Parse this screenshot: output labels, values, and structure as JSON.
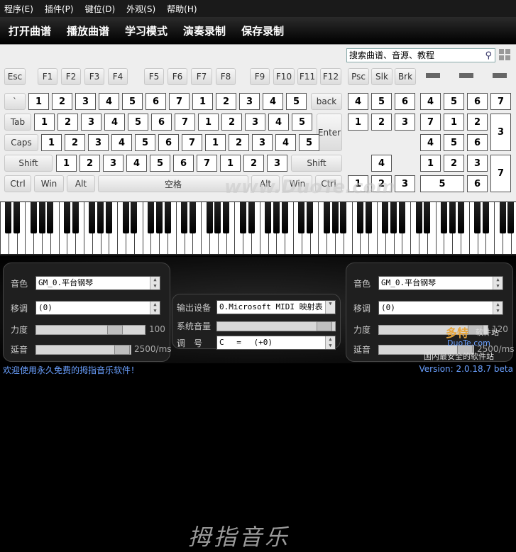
{
  "menu": [
    "程序(E)",
    "插件(P)",
    "键位(D)",
    "外观(S)",
    "帮助(H)"
  ],
  "toolbar": [
    "打开曲谱",
    "播放曲谱",
    "学习模式",
    "演奏录制",
    "保存录制"
  ],
  "search": {
    "placeholder": "搜索曲谱、音源、教程"
  },
  "fkeys": [
    "Esc",
    "F1",
    "F2",
    "F3",
    "F4",
    "F5",
    "F6",
    "F7",
    "F8",
    "F9",
    "F10",
    "F11",
    "F12",
    "Psc",
    "Slk",
    "Brk"
  ],
  "keys": {
    "backtick": "`",
    "back": "back",
    "tab": "Tab",
    "enter": "Enter",
    "caps": "Caps",
    "shift": "Shift",
    "ctrl": "Ctrl",
    "win": "Win",
    "alt": "Alt",
    "space": "空格"
  },
  "notes": {
    "row1": [
      "1",
      "2",
      "3",
      "4",
      "5",
      "6",
      "7",
      "1",
      "2",
      "3",
      "4",
      "5"
    ],
    "row2": [
      "1",
      "2",
      "3",
      "4",
      "5",
      "6",
      "7",
      "1",
      "2",
      "3",
      "4",
      "5"
    ],
    "row3": [
      "1",
      "2",
      "3",
      "4",
      "5",
      "6",
      "7",
      "1",
      "2",
      "3",
      "4",
      "5"
    ],
    "row4": [
      "1",
      "2",
      "3",
      "4",
      "5",
      "6",
      "7",
      "1",
      "2",
      "3"
    ],
    "nav": [
      "4",
      "5",
      "6",
      "1",
      "2",
      "3",
      "4",
      "1",
      "2",
      "3"
    ],
    "numpad": [
      "4",
      "5",
      "6",
      "7",
      "7",
      "1",
      "2",
      "3",
      "4",
      "5",
      "6",
      "1",
      "2",
      "3",
      "7",
      "5",
      "6"
    ]
  },
  "left_panel": {
    "instrument_label": "音色",
    "instrument": "GM_0.平台钢琴",
    "transpose_label": "移调",
    "transpose": "(0)",
    "velocity_label": "力度",
    "velocity": "100",
    "delay_label": "延音",
    "delay": "2500/ms"
  },
  "center_panel": {
    "output_label": "输出设备",
    "output": "0.Microsoft MIDI 映射表",
    "volume_label": "系统音量",
    "key_label": "调　号",
    "key": "C　 =　 (+0)"
  },
  "right_panel": {
    "instrument_label": "音色",
    "instrument": "GM_0.平台钢琴",
    "transpose_label": "移调",
    "transpose": "(0)",
    "velocity_label": "力度",
    "velocity": "120",
    "delay_label": "延音",
    "delay": "2500/ms"
  },
  "logo_text": "拇指音乐",
  "watermark": "www.DuoTe.com",
  "watermark2": {
    "brand": "多特",
    "suffix": "软件站",
    "url": "DuoTe.com",
    "slogan": "国内最安全的软件站"
  },
  "status": {
    "left": "欢迎使用永久免费的拇指音乐软件！",
    "right": "Version: 2.0.18.7 beta"
  }
}
